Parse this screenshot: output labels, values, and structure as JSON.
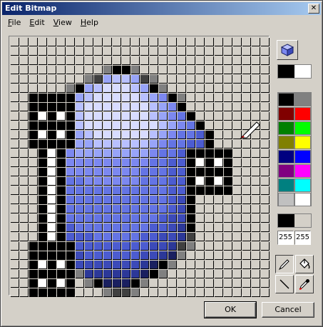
{
  "window": {
    "title": "Edit Bitmap",
    "close_label": "✕"
  },
  "menu": [
    {
      "label": "File",
      "accel": "F",
      "rest": "ile"
    },
    {
      "label": "Edit",
      "accel": "E",
      "rest": "dit"
    },
    {
      "label": "View",
      "accel": "V",
      "rest": "iew"
    },
    {
      "label": "Help",
      "accel": "H",
      "rest": "elp"
    }
  ],
  "grid": {
    "cols": 28,
    "rows": 28,
    "legend": {
      ".": "#d4d0c8",
      "K": "#000000",
      "W": "#ffffff",
      "G": "#808080",
      "D": "#404040",
      "L": "#c0c0c0",
      "a": "#d8dcff",
      "b": "#b8c0ff",
      "c": "#98a4f8",
      "d": "#7c88f0",
      "e": "#6474e4",
      "f": "#4c5cd0",
      "g": "#3c4ab8",
      "h": "#2c3898",
      "n": "#1a2060"
    },
    "pixels": [
      "............................",
      "............................",
      "............................",
      "..........GKKG..............",
      "........GDcbbcDG............",
      "......GKcbaaabcKG...........",
      "..KKKKKcbaaaaabcdKG.........",
      "..KKKKKbaaaaaaabcdK.........",
      "..KWKWKbaaaaaaabcdeK........",
      "..KKKKKbaaaaaaaabcdeK.......",
      "..KWKWKcbaaaaaabcdeefK......",
      "..KKKKKccbbbbbbcdeeffK......",
      "...KWKdccccccccdeefKKKKK....",
      "...KWKdddddddddeeffKWKWK....",
      "...KWKddddddddeeeffKKKKK....",
      "...KWKeeddddddeeeffKWKWK....",
      "...KWKeeeeeeeeeeeffKKKKK....",
      "...KWKeeeeeeeeeeefgK........",
      "...KWKeeeeeeeeeeefgK........",
      "...KWKeeeeeeeeeefggK........",
      "...KWKfeeeeeeeeffghK........",
      "...KWKfffeeeeeffgghD........",
      "..KKKKKffffffffgghDG........",
      "..KKKKKgffffffgghnG.........",
      "..KWKWKggggggghnKG..........",
      "..KKKKKGhhhhhhnKG...........",
      "..KWKWK.GKnnnKG.............",
      "..KKKKK...GDDG.............."
    ]
  },
  "tools": {
    "object_icon": "cube-icon",
    "pencil": "pencil-icon",
    "fill": "paint-bucket-icon",
    "line": "line-icon",
    "picker": "eyedropper-icon"
  },
  "colors": {
    "fg_bg_top": [
      "#000000",
      "#ffffff"
    ],
    "palette": [
      "#000000",
      "#808080",
      "#800000",
      "#ff0000",
      "#008000",
      "#00ff00",
      "#808000",
      "#ffff00",
      "#000080",
      "#0000ff",
      "#800080",
      "#ff00ff",
      "#008080",
      "#00ffff",
      "#c0c0c0",
      "#ffffff"
    ],
    "fg_bg_bottom": [
      "#000000",
      "#d4d0c8"
    ],
    "values": [
      "255",
      "255"
    ]
  },
  "buttons": {
    "ok": "OK",
    "cancel": "Cancel"
  }
}
